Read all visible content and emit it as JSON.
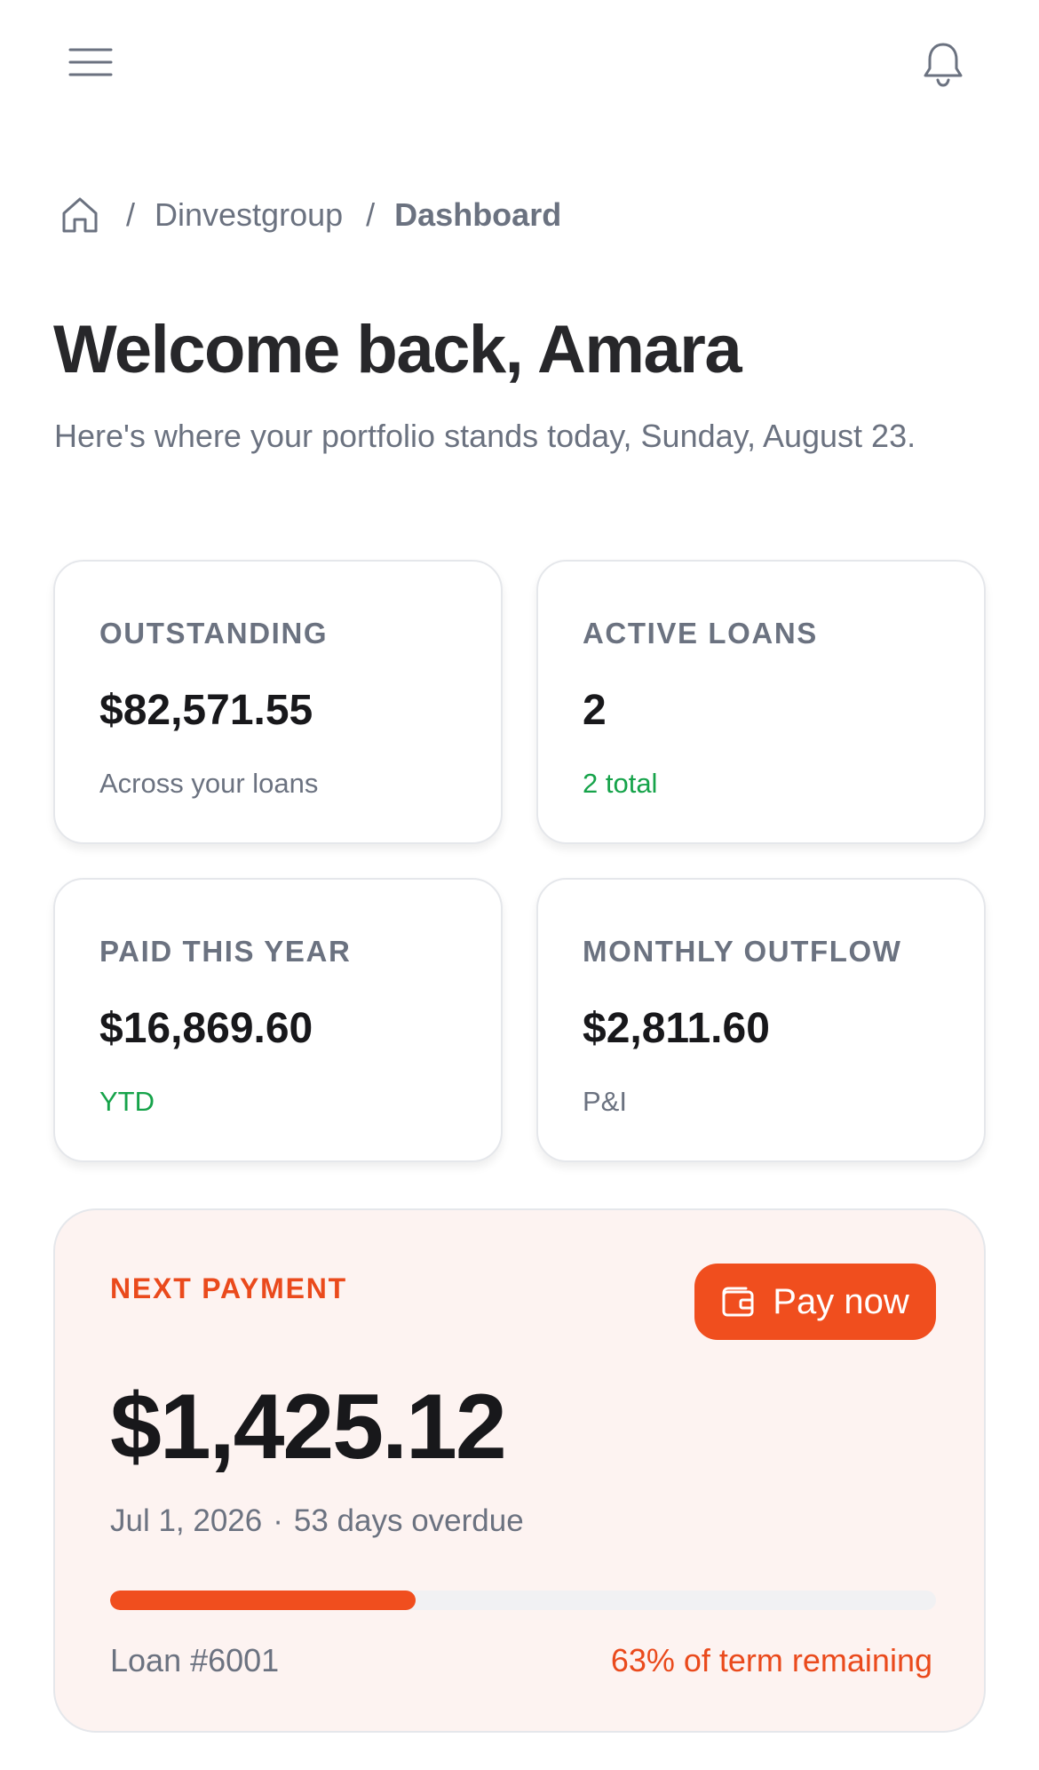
{
  "header": {
    "menu_icon": "hamburger-menu-icon",
    "notifications_icon": "bell-icon"
  },
  "breadcrumb": {
    "home_icon": "home-icon",
    "items": [
      "Dinvestgroup",
      "Dashboard"
    ],
    "separator": "/"
  },
  "page": {
    "title": "Welcome back, Amara",
    "subtitle": "Here's where your portfolio stands today, Sunday, August 23."
  },
  "stats": {
    "outstanding": {
      "label": "OUTSTANDING",
      "value": "$82,571.55",
      "sub": "Across your loans"
    },
    "active_loans": {
      "label": "ACTIVE LOANS",
      "value": "2",
      "sub": "2 total"
    },
    "paid_this_year": {
      "label": "PAID THIS YEAR",
      "value": "$16,869.60",
      "sub": "YTD"
    },
    "monthly_outflow": {
      "label": "MONTHLY OUTFLOW",
      "value": "$2,811.60",
      "sub": "P&I"
    }
  },
  "next_payment": {
    "label": "NEXT PAYMENT",
    "pay_button_label": "Pay now",
    "pay_button_icon": "wallet-icon",
    "amount": "$1,425.12",
    "due_date": "Jul 1, 2026",
    "separator": "·",
    "overdue_text": "53 days overdue",
    "progress_fraction": 0.37,
    "loan_id": "Loan #6001",
    "term_remaining": "63% of term remaining"
  },
  "colors": {
    "accent": "#f04e1e",
    "accent_text": "#ea4a1c",
    "positive": "#16a34a",
    "muted_text": "#6b7280",
    "next_card_bg": "#fdf3f1"
  }
}
